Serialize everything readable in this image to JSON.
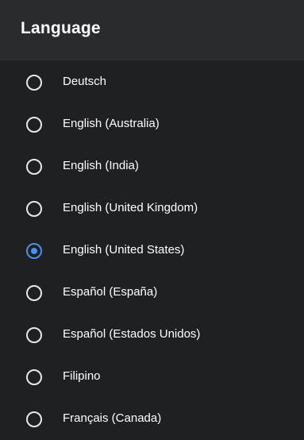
{
  "header": {
    "title": "Language"
  },
  "options": [
    {
      "label": "Deutsch",
      "selected": false
    },
    {
      "label": "English (Australia)",
      "selected": false
    },
    {
      "label": "English (India)",
      "selected": false
    },
    {
      "label": "English (United Kingdom)",
      "selected": false
    },
    {
      "label": "English (United States)",
      "selected": true
    },
    {
      "label": "Español (España)",
      "selected": false
    },
    {
      "label": "Español (Estados Unidos)",
      "selected": false
    },
    {
      "label": "Filipino",
      "selected": false
    },
    {
      "label": "Français (Canada)",
      "selected": false
    }
  ],
  "colors": {
    "accent": "#4a8ff0",
    "background": "#1f2022",
    "header": "#2a2b2d"
  }
}
